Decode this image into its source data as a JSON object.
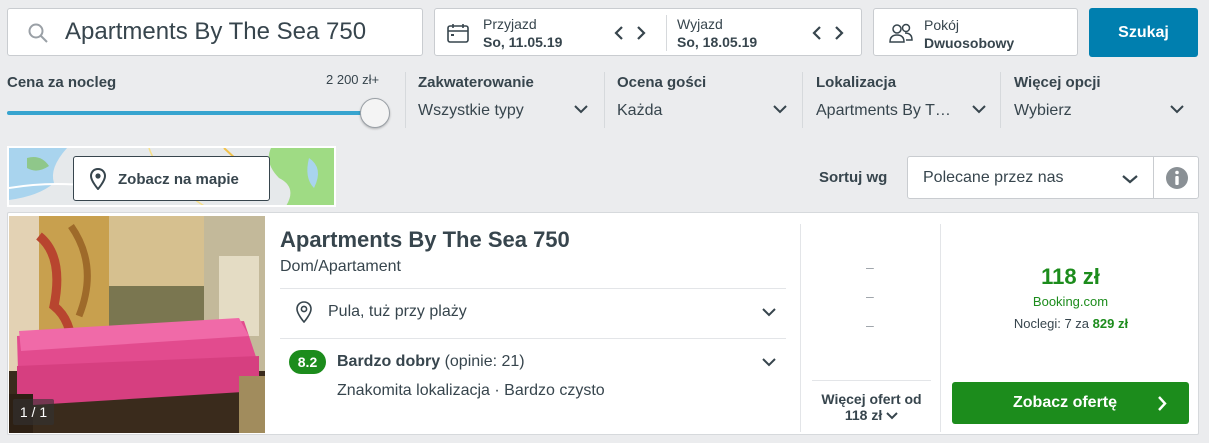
{
  "search": {
    "query": "Apartments By The Sea 750",
    "button_label": "Szukaj"
  },
  "dates": {
    "checkin": {
      "label": "Przyjazd",
      "value": "So, 11.05.19"
    },
    "checkout": {
      "label": "Wyjazd",
      "value": "So, 18.05.19"
    }
  },
  "room": {
    "label": "Pokój",
    "value": "Dwuosobowy"
  },
  "filters": {
    "price": {
      "label": "Cena za nocleg",
      "max": "2 200 zł+",
      "slider_fraction": 1.0
    },
    "accommodation": {
      "label": "Zakwaterowanie",
      "value": "Wszystkie typy"
    },
    "rating": {
      "label": "Ocena gości",
      "value": "Każda"
    },
    "location": {
      "label": "Lokalizacja",
      "value": "Apartments By T…"
    },
    "more": {
      "label": "Więcej opcji",
      "value": "Wybierz"
    }
  },
  "map": {
    "button_label": "Zobacz na mapie"
  },
  "sort": {
    "label": "Sortuj wg",
    "value": "Polecane przez nas"
  },
  "result": {
    "photo_counter": "1 / 1",
    "name": "Apartments By The Sea 750",
    "type": "Dom/Apartament",
    "location": "Pula, tuż przy plaży",
    "rating_score": "8.2",
    "rating_label": "Bardzo dobry",
    "rating_reviews": "(opinie: 21)",
    "rating_details": "Znakomita lokalizacja · Bardzo czysto",
    "alt_prices": [
      "–",
      "–",
      "–"
    ],
    "more_offers_line1": "Więcej ofert od",
    "more_offers_line2": "118 zł",
    "price": "118 zł",
    "provider": "Booking.com",
    "nights_prefix": "Noclegi: 7 za",
    "nights_total": "829 zł",
    "offer_button": "Zobacz ofertę"
  },
  "colors": {
    "accent_blue": "#007faf",
    "deal_green": "#1c8c1c",
    "slider": "#37a4cf"
  }
}
